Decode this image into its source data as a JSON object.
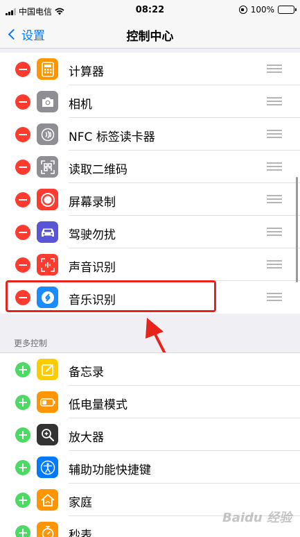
{
  "status_bar": {
    "carrier": "中国电信",
    "time": "08:22",
    "battery": "100%"
  },
  "nav": {
    "back_label": "设置",
    "title": "控制中心"
  },
  "included_controls": [
    {
      "label": "计算器",
      "icon": "calculator-icon",
      "color": "#ff9500"
    },
    {
      "label": "相机",
      "icon": "camera-icon",
      "color": "#8e8e93"
    },
    {
      "label": "NFC 标签读卡器",
      "icon": "nfc-icon",
      "color": "#8e8e93"
    },
    {
      "label": "读取二维码",
      "icon": "qr-code-icon",
      "color": "#8e8e93"
    },
    {
      "label": "屏幕录制",
      "icon": "screen-record-icon",
      "color": "#ff3b30"
    },
    {
      "label": "驾驶勿扰",
      "icon": "car-icon",
      "color": "#5856d6"
    },
    {
      "label": "声音识别",
      "icon": "sound-recognition-icon",
      "color": "#ff3b30"
    },
    {
      "label": "音乐识别",
      "icon": "shazam-icon",
      "color": "#1a8cff"
    }
  ],
  "more_controls_header": "更多控制",
  "more_controls": [
    {
      "label": "备忘录",
      "icon": "notes-icon",
      "color": "#ffcc00"
    },
    {
      "label": "低电量模式",
      "icon": "low-power-icon",
      "color": "#ff9500"
    },
    {
      "label": "放大器",
      "icon": "magnifier-icon",
      "color": "#333333"
    },
    {
      "label": "辅助功能快捷键",
      "icon": "accessibility-icon",
      "color": "#007aff"
    },
    {
      "label": "家庭",
      "icon": "home-icon",
      "color": "#ff9500"
    },
    {
      "label": "秒表",
      "icon": "stopwatch-icon",
      "color": "#ff9500"
    }
  ],
  "watermark": "Baidu 经验",
  "colors": {
    "accent": "#007aff",
    "remove": "#ff3b30",
    "add": "#4cd964",
    "highlight": "#e8231b"
  }
}
